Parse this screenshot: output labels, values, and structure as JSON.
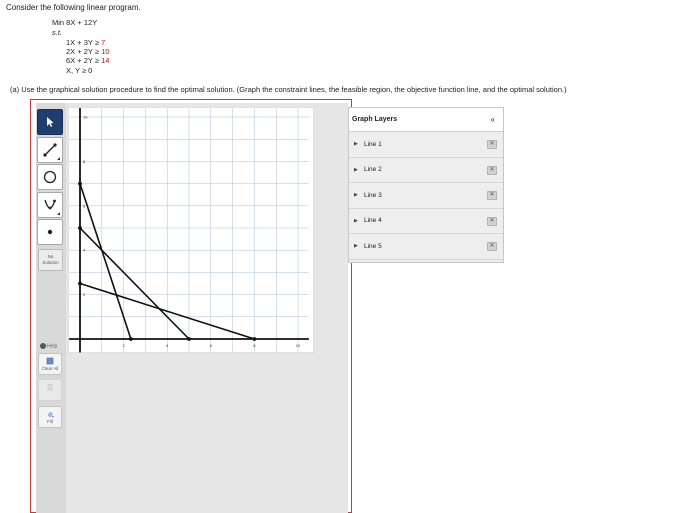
{
  "intro": "Consider the following linear program.",
  "lp": {
    "objective": "Min 8X + 12Y",
    "st": "s.t.",
    "constraints": [
      {
        "lhs": "1X + 3Y",
        "op": "≥",
        "rhs": "7"
      },
      {
        "lhs": "2X + 2Y",
        "op": "≥",
        "rhs": "10"
      },
      {
        "lhs": "6X + 2Y",
        "op": "≥",
        "rhs": "14"
      }
    ],
    "nonneg": "X, Y ≥ 0"
  },
  "question": "(a)  Use the graphical solution procedure to find the optimal solution. (Graph the constraint lines, the feasible region, the objective function line, and the optimal solution.)",
  "toolbar": {
    "no_solution": "No Solution",
    "help": "Help",
    "clear_all": "Clear All",
    "fill": "Fill"
  },
  "chart_data": {
    "type": "line",
    "xlim": [
      0,
      10
    ],
    "ylim": [
      0,
      10
    ],
    "x_ticks": [
      "2",
      "4",
      "6",
      "8",
      "10"
    ],
    "y_ticks": [
      "2",
      "4",
      "6",
      "8",
      "10"
    ],
    "grid": true,
    "series": [
      {
        "points": [
          [
            0,
            7
          ],
          [
            2.333,
            0
          ]
        ]
      },
      {
        "points": [
          [
            0,
            5
          ],
          [
            5,
            0
          ]
        ]
      },
      {
        "points": [
          [
            0,
            2.5
          ],
          [
            8,
            0
          ]
        ]
      }
    ]
  },
  "graph_layers": {
    "title": "Graph Layers",
    "collapse": "«",
    "items": [
      "Line 1",
      "Line 2",
      "Line 3",
      "Line 4",
      "Line 5"
    ]
  },
  "colors": {
    "frame": "#c5393d",
    "selected_tool": "#1f3e6e",
    "rhs": "#c41010"
  }
}
